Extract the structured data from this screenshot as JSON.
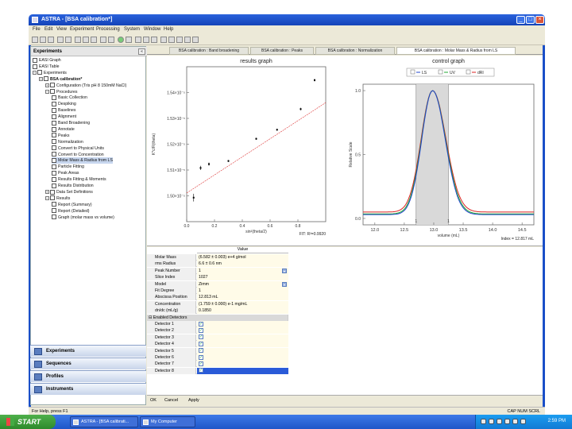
{
  "window": {
    "title": "ASTRA - [BSA calibration*]",
    "minimize": "_",
    "maximize": "□",
    "close": "×"
  },
  "menu": [
    "File",
    "Edit",
    "View",
    "Experiment",
    "Processing",
    "System",
    "Window",
    "Help"
  ],
  "tabs": [
    {
      "label": "BSA calibration : Band broadening"
    },
    {
      "label": "BSA calibration : Peaks"
    },
    {
      "label": "BSA calibration : Normalization"
    },
    {
      "label": "BSA calibration : Molar Mass & Radius from LS"
    }
  ],
  "sidebar": {
    "title": "Experiments",
    "close": "«",
    "items": [
      {
        "label": "EASI Graph",
        "indent": 0,
        "bold": false,
        "expander": ""
      },
      {
        "label": "EASI Table",
        "indent": 0,
        "bold": false,
        "expander": ""
      },
      {
        "label": "Experiments",
        "indent": 0,
        "bold": false,
        "expander": "−"
      },
      {
        "label": "BSA calibration*",
        "indent": 1,
        "bold": true,
        "expander": "−"
      },
      {
        "label": "Configuration (Tris pH 8 150mM NaCl)",
        "indent": 2,
        "bold": false,
        "expander": "+"
      },
      {
        "label": "Procedures",
        "indent": 2,
        "bold": false,
        "expander": "−"
      },
      {
        "label": "Basic Collection",
        "indent": 3,
        "bold": false,
        "expander": ""
      },
      {
        "label": "Despiking",
        "indent": 3,
        "bold": false,
        "expander": ""
      },
      {
        "label": "Baselines",
        "indent": 3,
        "bold": false,
        "expander": ""
      },
      {
        "label": "Alignment",
        "indent": 3,
        "bold": false,
        "expander": ""
      },
      {
        "label": "Band Broadening",
        "indent": 3,
        "bold": false,
        "expander": ""
      },
      {
        "label": "Annotate",
        "indent": 3,
        "bold": false,
        "expander": ""
      },
      {
        "label": "Peaks",
        "indent": 3,
        "bold": false,
        "expander": ""
      },
      {
        "label": "Normalization",
        "indent": 3,
        "bold": false,
        "expander": ""
      },
      {
        "label": "Convert to Physical Units",
        "indent": 3,
        "bold": false,
        "expander": ""
      },
      {
        "label": "Convert to Concentration",
        "indent": 3,
        "bold": false,
        "expander": ""
      },
      {
        "label": "Molar Mass & Radius from LS",
        "indent": 3,
        "bold": false,
        "expander": "",
        "selected": true
      },
      {
        "label": "Particle Fitting",
        "indent": 3,
        "bold": false,
        "expander": ""
      },
      {
        "label": "Peak Areas",
        "indent": 3,
        "bold": false,
        "expander": ""
      },
      {
        "label": "Results Fitting & Moments",
        "indent": 3,
        "bold": false,
        "expander": ""
      },
      {
        "label": "Results Distribution",
        "indent": 3,
        "bold": false,
        "expander": ""
      },
      {
        "label": "Data Set Definitions",
        "indent": 2,
        "bold": false,
        "expander": "+"
      },
      {
        "label": "Results",
        "indent": 2,
        "bold": false,
        "expander": "−"
      },
      {
        "label": "Report (Summary)",
        "indent": 3,
        "bold": false,
        "expander": ""
      },
      {
        "label": "Report (Detailed)",
        "indent": 3,
        "bold": false,
        "expander": ""
      },
      {
        "label": "Graph (molar mass vs volume)",
        "indent": 3,
        "bold": false,
        "expander": ""
      }
    ],
    "nav": [
      "Experiments",
      "Sequences",
      "Profiles",
      "Instruments"
    ]
  },
  "results_graph": {
    "title": "results graph",
    "footer": "FIT: R²=0.9920"
  },
  "control_graph": {
    "title": "control graph",
    "legend": [
      "LS",
      "UV",
      "dRI"
    ],
    "footer": "Index = 12.817 mL"
  },
  "chart_data": [
    {
      "type": "scatter",
      "title": "results graph",
      "xlabel": "sin²(theta/2)",
      "ylabel": "K*c/R(theta)",
      "xlim": [
        0.0,
        1.0
      ],
      "ylim": [
        1.49e-05,
        1.55e-05
      ],
      "yticks": [
        {
          "value": 1.5e-05,
          "label": "1.50×10⁻⁵"
        },
        {
          "value": 1.51e-05,
          "label": "1.51×10⁻⁵"
        },
        {
          "value": 1.52e-05,
          "label": "1.52×10⁻⁵"
        },
        {
          "value": 1.53e-05,
          "label": "1.53×10⁻⁵"
        },
        {
          "value": 1.54e-05,
          "label": "1.54×10⁻⁵"
        }
      ],
      "xticks": [
        {
          "value": 0.0,
          "label": "0.0"
        },
        {
          "value": 0.2,
          "label": "0.2"
        },
        {
          "value": 0.4,
          "label": "0.4"
        },
        {
          "value": 0.6,
          "label": "0.6"
        },
        {
          "value": 0.8,
          "label": "0.8"
        }
      ],
      "points": [
        {
          "x": 0.05,
          "y": 1.4993e-05,
          "err": 1.5e-08
        },
        {
          "x": 0.1,
          "y": 1.5108e-05,
          "err": 8e-09
        },
        {
          "x": 0.16,
          "y": 1.5123e-05,
          "err": 6e-09
        },
        {
          "x": 0.3,
          "y": 1.5135e-05,
          "err": 4e-09
        },
        {
          "x": 0.5,
          "y": 1.5221e-05,
          "err": 4e-09
        },
        {
          "x": 0.65,
          "y": 1.5256e-05,
          "err": 4e-09
        },
        {
          "x": 0.82,
          "y": 1.5336e-05,
          "err": 5e-09
        },
        {
          "x": 0.92,
          "y": 1.5448e-05,
          "err": 5e-09
        }
      ],
      "fit_line": {
        "x": [
          0.0,
          1.0
        ],
        "y": [
          1.5011e-05,
          1.5361e-05
        ]
      }
    },
    {
      "type": "line",
      "title": "control graph",
      "xlabel": "volume (mL)",
      "ylabel": "Relative Scale",
      "xlim": [
        11.8,
        14.7
      ],
      "ylim": [
        -0.05,
        1.05
      ],
      "xticks": [
        {
          "value": 12.0,
          "label": "12.0"
        },
        {
          "value": 12.5,
          "label": "12.5"
        },
        {
          "value": 13.0,
          "label": "13.0"
        },
        {
          "value": 13.5,
          "label": "13.5"
        },
        {
          "value": 14.0,
          "label": "14.0"
        },
        {
          "value": 14.5,
          "label": "14.5"
        }
      ],
      "yticks": [
        {
          "value": 0.0,
          "label": "0.0"
        },
        {
          "value": 0.5,
          "label": "0.5"
        },
        {
          "value": 1.0,
          "label": "1.0"
        }
      ],
      "peak_region": [
        12.7,
        13.25
      ],
      "peak_markers": [
        {
          "x": 12.7,
          "label": "1"
        },
        {
          "x": 13.25,
          "label": "1"
        }
      ],
      "series": [
        {
          "name": "LS",
          "color": "#2244cc",
          "peak": 12.98,
          "width": 0.2,
          "baseline": 0.03
        },
        {
          "name": "UV",
          "color": "#22aa33",
          "peak": 12.98,
          "width": 0.205,
          "baseline": 0.035
        },
        {
          "name": "dRI",
          "color": "#dd2222",
          "peak": 12.98,
          "width": 0.21,
          "baseline": 0.05
        }
      ]
    }
  ],
  "properties": {
    "header": "Value",
    "rows": [
      {
        "key": "Molar Mass",
        "value": "(6.582 ± 0.003) e+4 g/mol",
        "dropdown": false
      },
      {
        "key": "rms Radius",
        "value": "6.6 ± 0.6 nm",
        "dropdown": false
      },
      {
        "key": "Peak Number",
        "value": "1",
        "dropdown": true
      },
      {
        "key": "Slice Index",
        "value": "1027",
        "dropdown": false
      },
      {
        "key": "Model",
        "value": "Zimm",
        "dropdown": true
      },
      {
        "key": "Fit Degree",
        "value": "1",
        "dropdown": false
      },
      {
        "key": "Abscissa Position",
        "value": "12.813 mL",
        "dropdown": false
      },
      {
        "key": "Concentration",
        "value": "(1.759 ± 0.000) e-1 mg/mL",
        "dropdown": false
      },
      {
        "key": "dn/dc (mL/g)",
        "value": "0.1850",
        "dropdown": false
      }
    ],
    "group_label": "Enabled Detectors",
    "detectors": [
      "Detector 1",
      "Detector 2",
      "Detector 3",
      "Detector 4",
      "Detector 5",
      "Detector 6",
      "Detector 7",
      "Detector 8"
    ],
    "buttons": [
      "OK",
      "Cancel",
      "Apply"
    ]
  },
  "status": {
    "left": "For Help, press F1",
    "right": "CAP   NUM   SCRL"
  },
  "taskbar": {
    "start": "START",
    "tasks": [
      "ASTRA - [BSA calibrati...",
      "My Computer"
    ],
    "clock": "2:59 PM"
  }
}
